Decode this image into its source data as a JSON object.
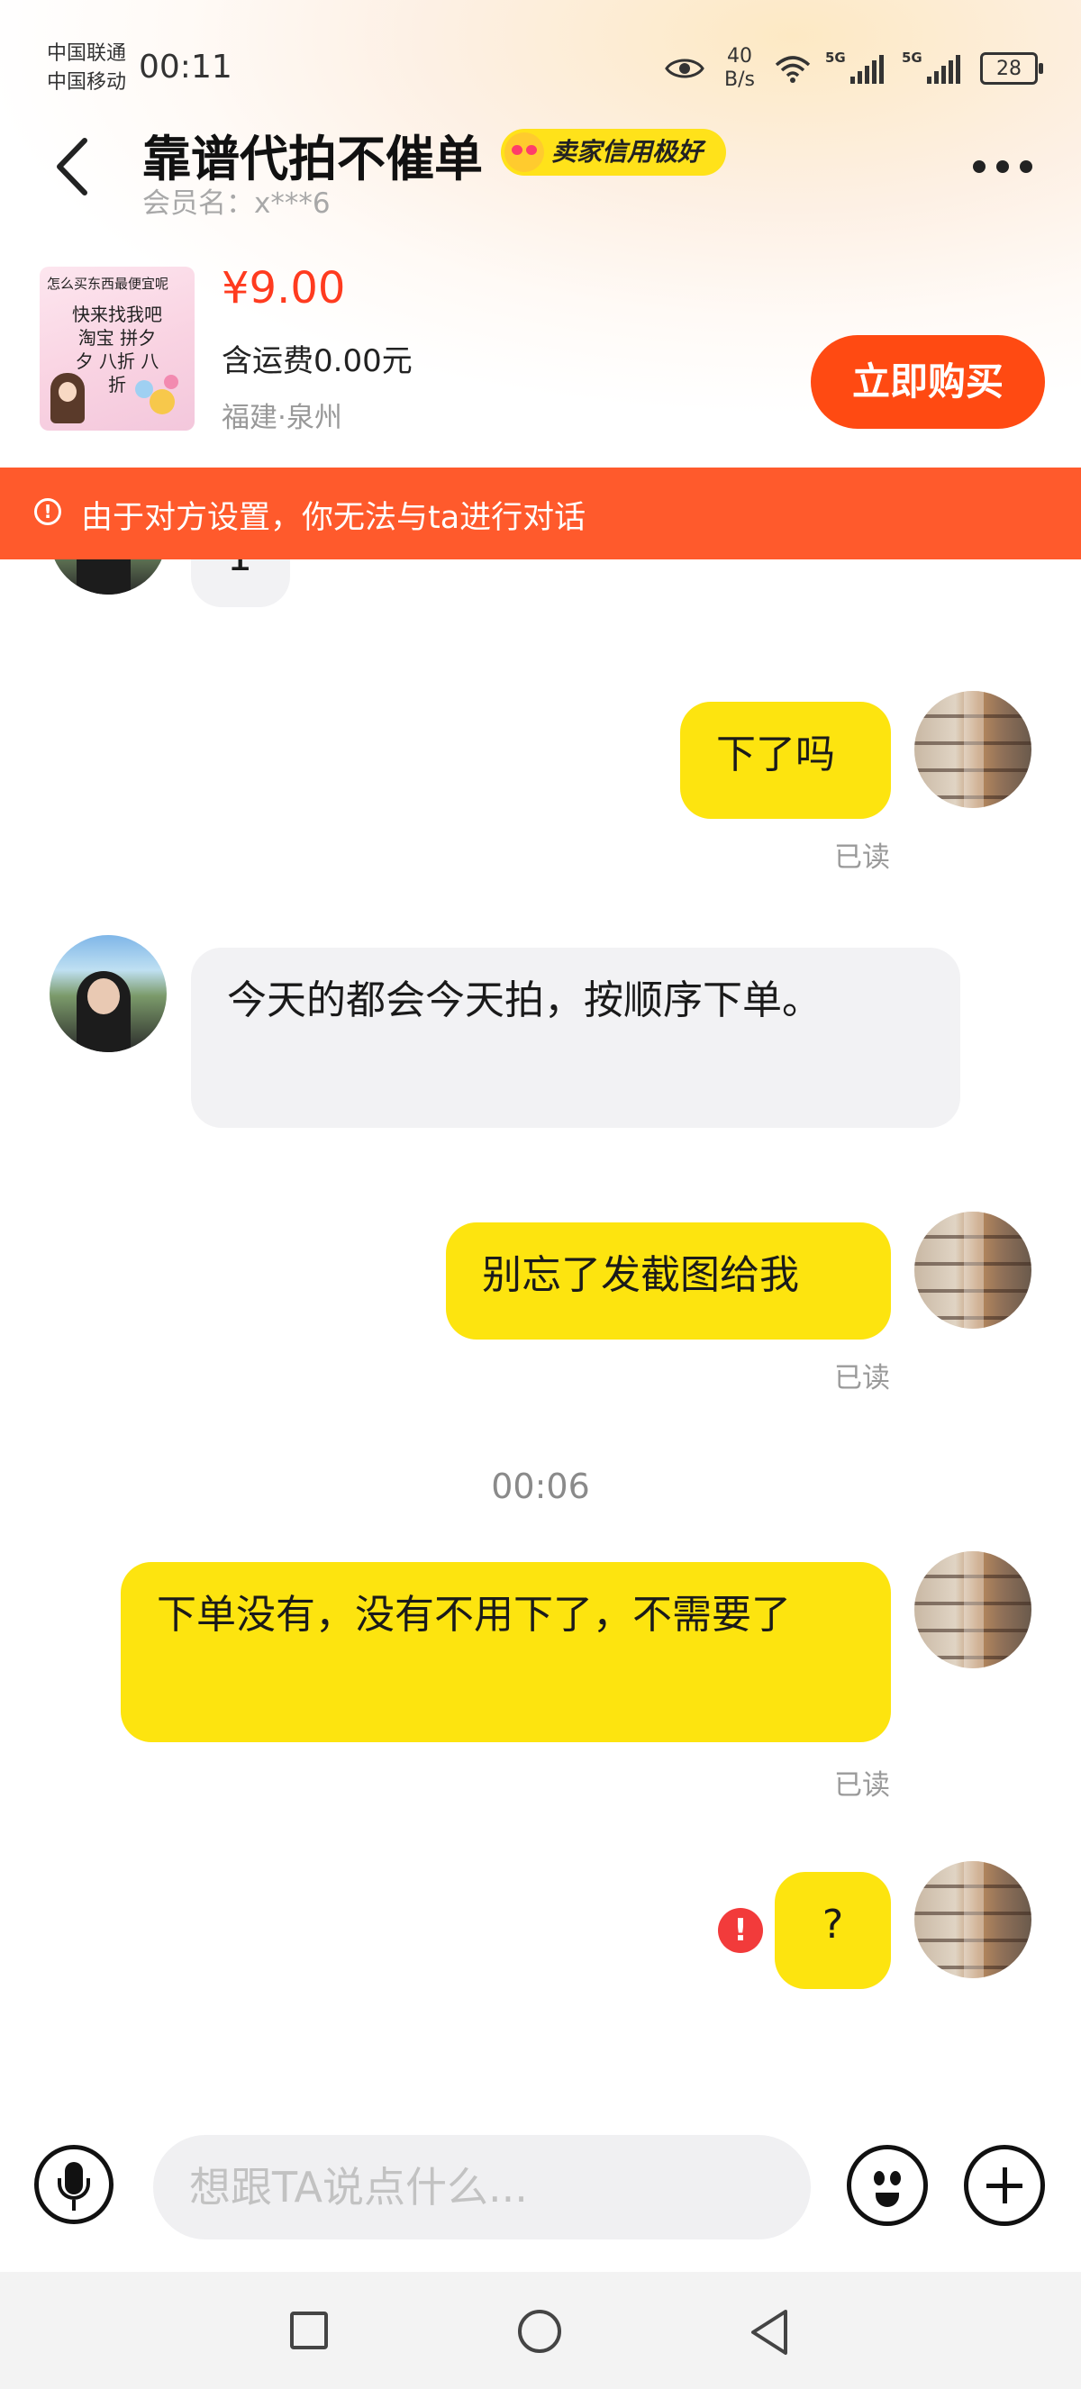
{
  "status_bar": {
    "carrier_1": "中国联通",
    "carrier_2": "中国移动",
    "time": "00:11",
    "net_speed_value": "40",
    "net_speed_unit": "B/s",
    "signal_1_label": "5G",
    "signal_2_label": "5G",
    "battery": "28"
  },
  "header": {
    "shop_name": "靠谱代拍不催单",
    "badge": "卖家信用极好",
    "member_name": "会员名：x***6"
  },
  "product": {
    "image_text_top": "怎么买东西最便宜呢",
    "image_text_main": "快来找我吧 淘宝 拼夕夕 八折 八折",
    "price": "¥9.00",
    "shipping": "含运费0.00元",
    "location": "福建·泉州",
    "buy_label": "立即购买"
  },
  "notice": {
    "icon": "!",
    "text": "由于对方设置，你无法与ta进行对话"
  },
  "messages": [
    {
      "from": "other",
      "text": "1"
    },
    {
      "from": "me",
      "text": "下了吗",
      "status": "已读"
    },
    {
      "from": "other",
      "text": "今天的都会今天拍，按顺序下单。"
    },
    {
      "from": "me",
      "text": "别忘了发截图给我",
      "status": "已读"
    },
    {
      "type": "time",
      "text": "00:06"
    },
    {
      "from": "me",
      "text": "下单没有，没有不用下了，不需要了",
      "status": "已读"
    },
    {
      "from": "me",
      "text": "?",
      "failed": true,
      "failed_icon": "!"
    }
  ],
  "input": {
    "placeholder": "想跟TA说点什么..."
  },
  "icons": {
    "back": "chevron-left-icon",
    "more": "more-dots-icon",
    "mic": "microphone-icon",
    "emoji": "emoji-icon",
    "plus": "plus-icon"
  },
  "colors": {
    "accent_orange": "#ff4a12",
    "notice_bar": "#ff5a2c",
    "my_bubble": "#fde40f",
    "price_red": "#ff3b1f"
  }
}
